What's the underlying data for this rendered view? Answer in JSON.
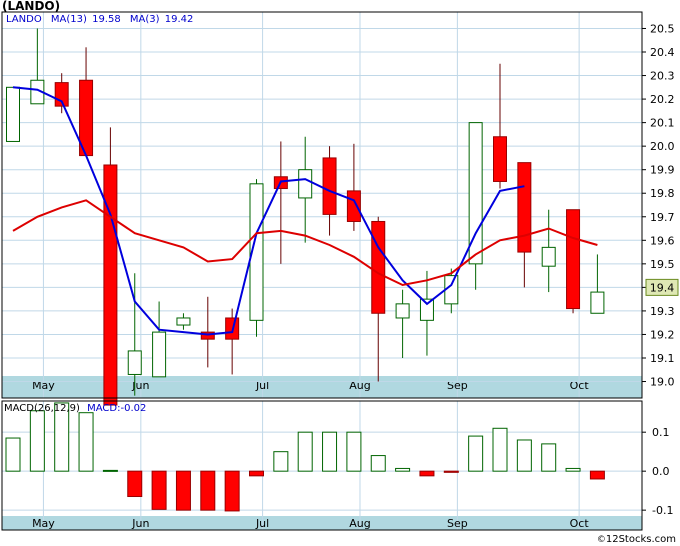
{
  "title": "(LANDO)",
  "legend": {
    "symbol": "LANDO",
    "ma13_label": "MA(13)",
    "ma13_value": "19.58",
    "ma3_label": "MA(3)",
    "ma3_value": "19.42",
    "macd_label": "MACD(26,12,9)",
    "macd_value": "MACD:-0.02"
  },
  "credit": {
    "symbol": "©",
    "text": "12Stocks.com"
  },
  "colors": {
    "up_candle": "#006400",
    "down_candle": "#ff0000",
    "ma13": "#0000dd",
    "ma3": "#dd0000",
    "grid": "#c0d8e8",
    "axis_band": "#b0d8e0",
    "price_box_bg": "#dfe8b4"
  },
  "chart_data": [
    {
      "type": "candlestick",
      "title": "(LANDO)",
      "x_ticks": [
        "May",
        "Jun",
        "Jul",
        "Aug",
        "Sep",
        "Oct"
      ],
      "x_tick_positions": [
        1.25,
        5.25,
        10.25,
        14.25,
        18.25,
        23.25
      ],
      "ylim": [
        18.93,
        20.57
      ],
      "y_ticks": [
        "20.5",
        "20.4",
        "20.3",
        "20.2",
        "20.1",
        "20.0",
        "19.9",
        "19.8",
        "19.7",
        "19.6",
        "19.5",
        "19.4",
        "19.3",
        "19.2",
        "19.1",
        "19.0"
      ],
      "last_price": "19.4",
      "candles": [
        {
          "o": 20.02,
          "h": 20.25,
          "l": 20.02,
          "c": 20.25
        },
        {
          "o": 20.18,
          "h": 20.5,
          "l": 20.18,
          "c": 20.28
        },
        {
          "o": 20.27,
          "h": 20.31,
          "l": 20.14,
          "c": 20.17
        },
        {
          "o": 20.28,
          "h": 20.42,
          "l": 19.96,
          "c": 19.96
        },
        {
          "o": 19.92,
          "h": 20.08,
          "l": 18.9,
          "c": 18.9
        },
        {
          "o": 19.03,
          "h": 19.46,
          "l": 18.94,
          "c": 19.13
        },
        {
          "o": 19.02,
          "h": 19.34,
          "l": 19.02,
          "c": 19.21
        },
        {
          "o": 19.24,
          "h": 19.29,
          "l": 19.22,
          "c": 19.27
        },
        {
          "o": 19.21,
          "h": 19.36,
          "l": 19.06,
          "c": 19.18
        },
        {
          "o": 19.27,
          "h": 19.31,
          "l": 19.03,
          "c": 19.18
        },
        {
          "o": 19.26,
          "h": 19.86,
          "l": 19.19,
          "c": 19.84
        },
        {
          "o": 19.87,
          "h": 20.02,
          "l": 19.5,
          "c": 19.82
        },
        {
          "o": 19.78,
          "h": 20.04,
          "l": 19.59,
          "c": 19.9
        },
        {
          "o": 19.95,
          "h": 20.0,
          "l": 19.62,
          "c": 19.71
        },
        {
          "o": 19.81,
          "h": 20.01,
          "l": 19.64,
          "c": 19.68
        },
        {
          "o": 19.68,
          "h": 19.7,
          "l": 19.0,
          "c": 19.29
        },
        {
          "o": 19.27,
          "h": 19.39,
          "l": 19.1,
          "c": 19.33
        },
        {
          "o": 19.26,
          "h": 19.47,
          "l": 19.11,
          "c": 19.35
        },
        {
          "o": 19.33,
          "h": 19.48,
          "l": 19.29,
          "c": 19.45
        },
        {
          "o": 19.5,
          "h": 20.1,
          "l": 19.39,
          "c": 20.1
        },
        {
          "o": 20.04,
          "h": 20.35,
          "l": 19.82,
          "c": 19.85
        },
        {
          "o": 19.93,
          "h": 19.93,
          "l": 19.4,
          "c": 19.55
        },
        {
          "o": 19.49,
          "h": 19.73,
          "l": 19.38,
          "c": 19.57
        },
        {
          "o": 19.73,
          "h": 19.73,
          "l": 19.29,
          "c": 19.31
        },
        {
          "o": 19.29,
          "h": 19.54,
          "l": 19.29,
          "c": 19.38
        }
      ],
      "ma3": [
        19.64,
        19.7,
        19.74,
        19.77,
        19.92,
        19.43,
        19.09,
        19.2,
        19.22,
        19.22,
        19.41,
        19.63,
        19.85,
        19.86,
        19.77,
        19.61,
        19.42,
        19.33,
        19.42,
        19.6,
        19.81,
        19.83
      ],
      "ma3_start": 0,
      "ma13": [
        20.25,
        20.22,
        20.18,
        19.76,
        19.34,
        19.1,
        18.96,
        18.81
      ],
      "ma13_full": [
        19.64,
        19.7,
        19.74,
        19.77,
        19.92,
        19.43,
        19.09,
        19.2,
        19.22,
        19.22,
        19.41,
        19.63,
        19.85,
        19.86,
        19.77,
        19.61,
        19.42,
        19.33,
        19.42,
        19.6,
        19.81,
        19.83
      ]
    },
    {
      "type": "bar",
      "title": "MACD(26,12,9)",
      "ylim": [
        -0.115,
        0.18
      ],
      "y_ticks": [
        "0.1",
        "0.0",
        "-0.1"
      ],
      "x_ticks": [
        "May",
        "Jun",
        "Jul",
        "Aug",
        "Sep",
        "Oct"
      ],
      "values": [
        0.085,
        0.155,
        0.175,
        0.15,
        0.002,
        -0.065,
        -0.098,
        -0.1,
        -0.1,
        -0.102,
        -0.012,
        0.05,
        0.1,
        0.1,
        0.1,
        0.04,
        0.007,
        -0.012,
        -0.003,
        0.09,
        0.11,
        0.08,
        0.07,
        0.007,
        -0.02
      ]
    }
  ]
}
